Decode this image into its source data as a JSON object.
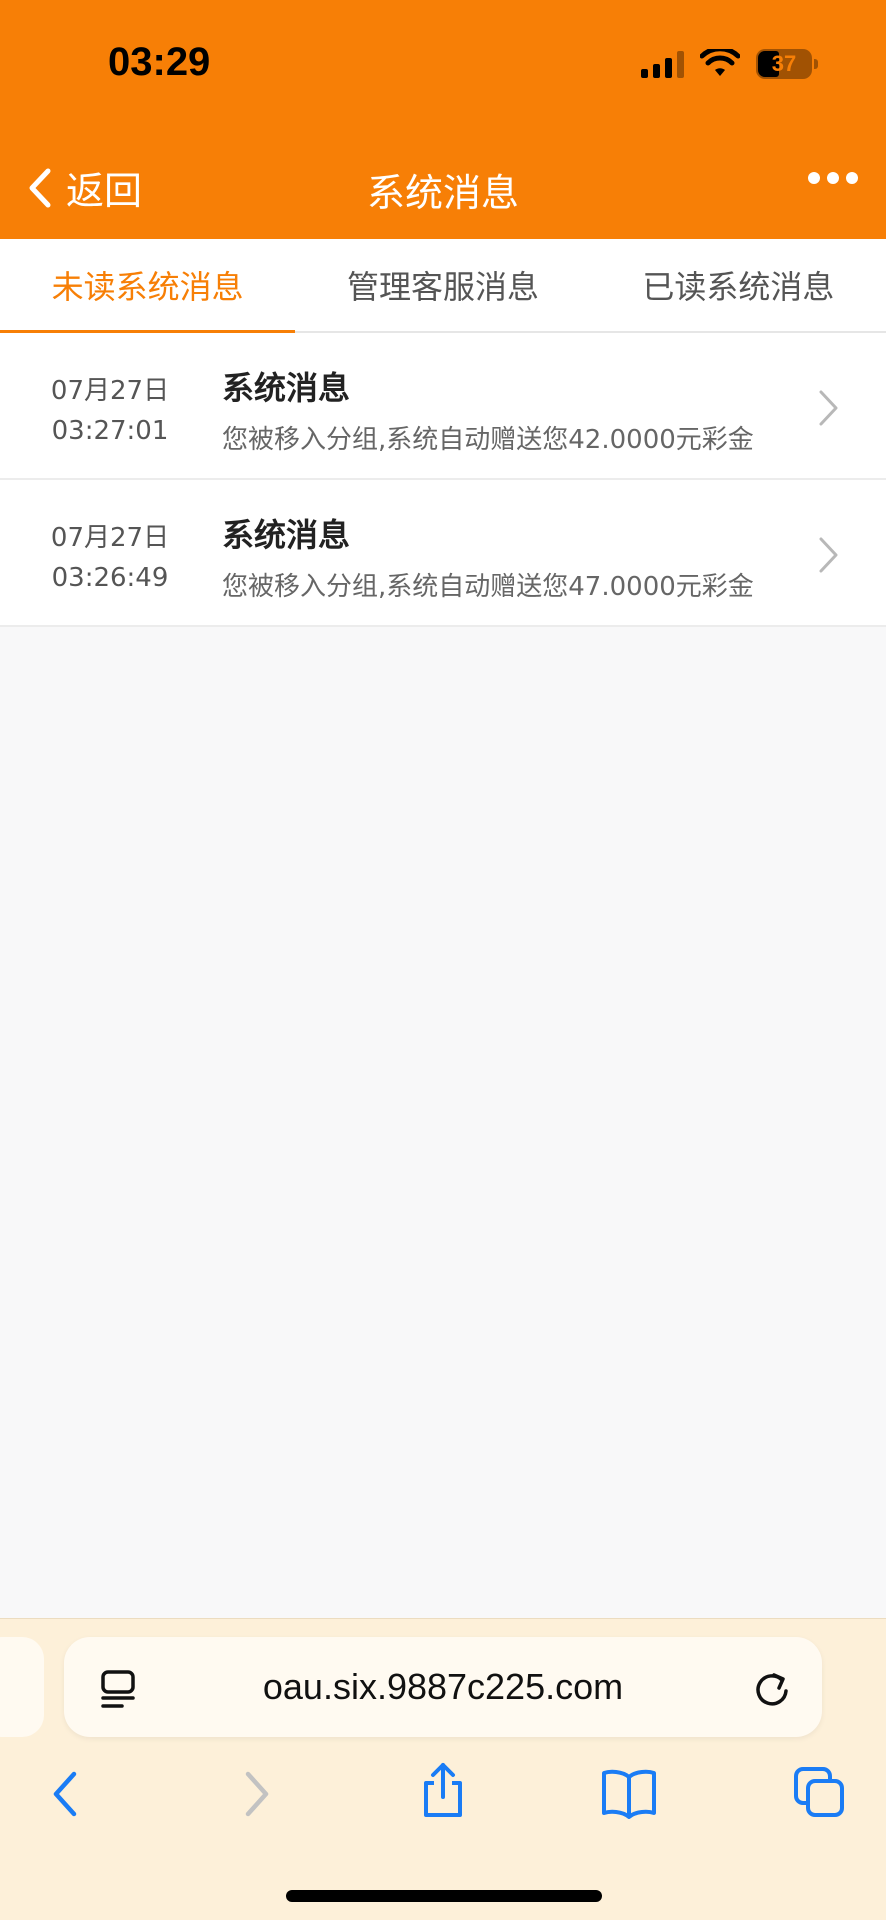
{
  "status_bar": {
    "time": "03:29",
    "battery": "37"
  },
  "header": {
    "back_label": "返回",
    "title": "系统消息",
    "more_icon": "ellipsis-icon"
  },
  "tabs": [
    {
      "label": "未读系统消息",
      "active": true
    },
    {
      "label": "管理客服消息",
      "active": false
    },
    {
      "label": "已读系统消息",
      "active": false
    }
  ],
  "messages": [
    {
      "date": "07月27日",
      "time": "03:27:01",
      "title": "系统消息",
      "body": "您被移入分组,系统自动赠送您42.0000元彩金"
    },
    {
      "date": "07月27日",
      "time": "03:26:49",
      "title": "系统消息",
      "body": "您被移入分组,系统自动赠送您47.0000元彩金"
    }
  ],
  "browser": {
    "url": "oau.six.9887c225.com"
  },
  "colors": {
    "brand": "#f77f06",
    "browser_bar": "#fdf0d9",
    "browser_icon": "#1a7cf5"
  }
}
